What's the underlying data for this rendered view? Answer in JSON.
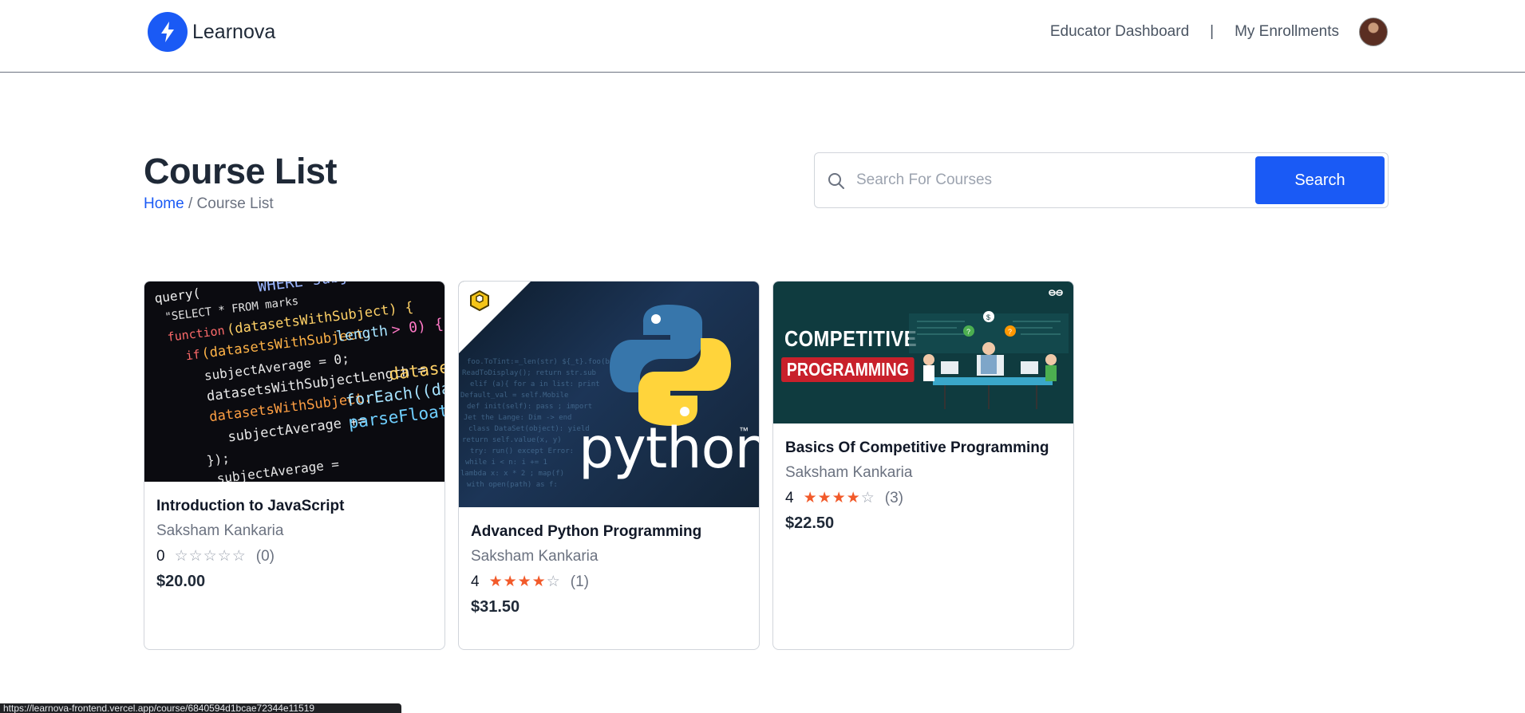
{
  "brand": {
    "name": "Learnova",
    "icon": "lightning-bolt-icon",
    "color": "#1a5af5"
  },
  "nav": {
    "educator_dashboard": "Educator Dashboard",
    "separator": "|",
    "my_enrollments": "My Enrollments"
  },
  "page": {
    "title": "Course List",
    "breadcrumb_home": "Home",
    "breadcrumb_rest": "/ Course List"
  },
  "search": {
    "placeholder": "Search For Courses",
    "value": "",
    "button_label": "Search"
  },
  "courses": [
    {
      "title": "Introduction to JavaScript",
      "educator": "Saksham Kankaria",
      "rating": "0",
      "rating_value": 0,
      "stars": "☆☆☆☆☆",
      "stars_filled": "",
      "stars_empty": "☆☆☆☆☆",
      "count": "(0)",
      "price": "$20.00"
    },
    {
      "title": "Advanced Python Programming",
      "educator": "Saksham Kankaria",
      "rating": "4",
      "rating_value": 4,
      "stars_filled": "★★★★",
      "stars_empty": "☆",
      "count": "(1)",
      "price": "$31.50",
      "thumbnail_text": "python",
      "thumbnail_tm": "™"
    },
    {
      "title": "Basics Of Competitive Programming",
      "educator": "Saksham Kankaria",
      "rating": "4",
      "rating_value": 4,
      "stars_filled": "★★★★",
      "stars_empty": "☆",
      "count": "(3)",
      "price": "$22.50",
      "thumbnail_line1": "COMPETITIVE",
      "thumbnail_line2": "PROGRAMMING"
    }
  ],
  "status_bar": {
    "url": "https://learnova-frontend.vercel.app/course/6840594d1bcae72344e11519"
  }
}
